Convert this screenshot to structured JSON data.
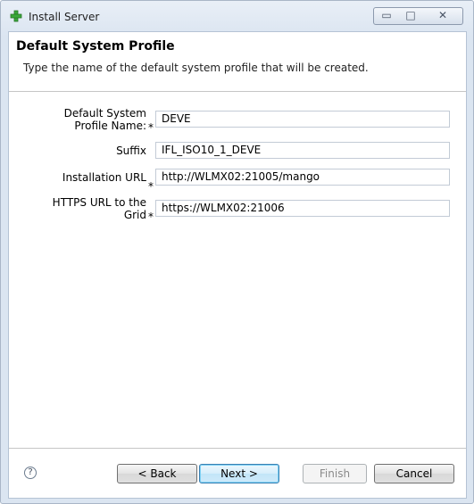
{
  "window": {
    "title": "Install Server",
    "controls": {
      "minimize": "▭",
      "maximize": "□",
      "close": "✕"
    }
  },
  "header": {
    "title": "Default System Profile",
    "description": "Type the name of the default system profile that will be created."
  },
  "form": {
    "required_marker": "*",
    "fields": [
      {
        "label_line1": "Default System",
        "label_line2": "Profile Name:",
        "value": "DEVE",
        "required": true
      },
      {
        "label_line1": "Suffix",
        "label_line2": "",
        "value": "IFL_ISO10_1_DEVE",
        "required": false
      },
      {
        "label_line1": "Installation URL",
        "label_line2": "",
        "value": "http://WLMX02:21005/mango",
        "required": true
      },
      {
        "label_line1": "HTTPS URL to the",
        "label_line2": "Grid",
        "value": "https://WLMX02:21006",
        "required": true
      }
    ]
  },
  "footer": {
    "help_icon": "?",
    "back_label": "< Back",
    "next_label": "Next >",
    "finish_label": "Finish",
    "cancel_label": "Cancel"
  },
  "colors": {
    "accent": "#3c7fb1",
    "title_icon": "#3aa83a",
    "frame": "#dbe5f1"
  }
}
